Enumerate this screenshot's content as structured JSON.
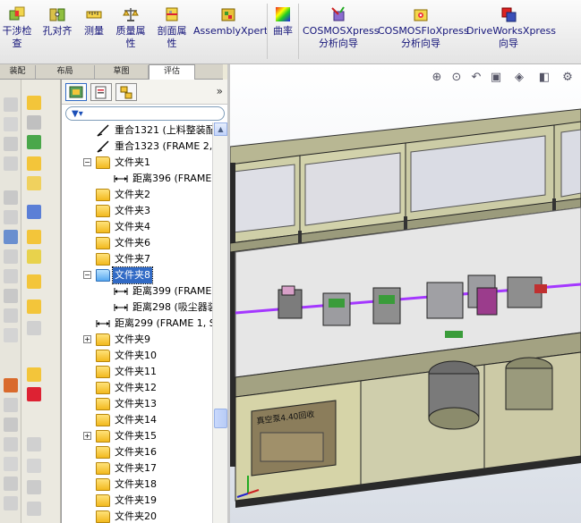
{
  "ribbon": {
    "items": [
      {
        "label": "干涉检查",
        "icon": "interference-check-icon"
      },
      {
        "label": "孔对齐",
        "icon": "hole-alignment-icon"
      },
      {
        "label": "测量",
        "icon": "measure-icon"
      },
      {
        "label": "质量属性",
        "icon": "mass-properties-icon"
      },
      {
        "label": "剖面属性",
        "icon": "section-properties-icon"
      },
      {
        "label": "AssemblyXpert",
        "icon": "assemblyxpert-icon"
      },
      {
        "label": "曲率",
        "icon": "curvature-icon"
      },
      {
        "label": "COSMOSXpress 分析向导",
        "icon": "cosmosxpress-icon"
      },
      {
        "label": "COSMOSFloXpress 分析向导",
        "icon": "cosmosfloxpress-icon"
      },
      {
        "label": "DriveWorksXpress 向导",
        "icon": "driveworksxpress-icon"
      }
    ],
    "labels": {
      "interference_1": "干涉检",
      "interference_2": "查",
      "hole": "孔对齐",
      "measure": "测量",
      "mass_1": "质量属",
      "mass_2": "性",
      "section_1": "剖面属",
      "section_2": "性",
      "assembly": "AssemblyXpert",
      "curvature": "曲率",
      "cosmos_1": "COSMOSXpress",
      "cosmos_2": "分析向导",
      "flo_1": "COSMOSFloXpress",
      "flo_2": "分析向导",
      "drive_1": "DriveWorksXpress",
      "drive_2": "向导"
    }
  },
  "tabs": [
    {
      "label": "装配"
    },
    {
      "label": "布局"
    },
    {
      "label": "草图"
    },
    {
      "label": "评估",
      "active": true
    }
  ],
  "tree": {
    "filter_icon": "filter-icon",
    "rows": [
      {
        "label": "重合1321 (上料整装配",
        "type": "mate"
      },
      {
        "label": "重合1323 (FRAME 2, S",
        "type": "mate"
      },
      {
        "label": "文件夹1",
        "type": "folder",
        "expanded": true
      },
      {
        "label": "距离396 (FRAME 1",
        "type": "distance"
      },
      {
        "label": "文件夹2",
        "type": "folder"
      },
      {
        "label": "文件夹3",
        "type": "folder"
      },
      {
        "label": "文件夹4",
        "type": "folder"
      },
      {
        "label": "文件夹6",
        "type": "folder"
      },
      {
        "label": "文件夹7",
        "type": "folder"
      },
      {
        "label": "文件夹8",
        "type": "folder",
        "expanded": true,
        "selected": true
      },
      {
        "label": "距离399 (FRAME 1",
        "type": "distance"
      },
      {
        "label": "距离298 (吸尘器装",
        "type": "distance"
      },
      {
        "label": "距离299 (FRAME 1, SF",
        "type": "distance"
      },
      {
        "label": "文件夹9",
        "type": "folder",
        "collapsed": true
      },
      {
        "label": "文件夹10",
        "type": "folder"
      },
      {
        "label": "文件夹11",
        "type": "folder"
      },
      {
        "label": "文件夹12",
        "type": "folder"
      },
      {
        "label": "文件夹13",
        "type": "folder"
      },
      {
        "label": "文件夹14",
        "type": "folder"
      },
      {
        "label": "文件夹15",
        "type": "folder",
        "collapsed": true
      },
      {
        "label": "文件夹16",
        "type": "folder"
      },
      {
        "label": "文件夹17",
        "type": "folder"
      },
      {
        "label": "文件夹18",
        "type": "folder"
      },
      {
        "label": "文件夹19",
        "type": "folder"
      },
      {
        "label": "文件夹20",
        "type": "folder"
      }
    ]
  },
  "panel_expand": "»",
  "view": {
    "machine_label": "真空泵4.40回收"
  },
  "colors": {
    "selection": "#316ac5",
    "folder": "#f2b91e",
    "machine_body": "#c9c8a0",
    "frame": "#2a2a2a",
    "mate_line": "#a437ff"
  }
}
